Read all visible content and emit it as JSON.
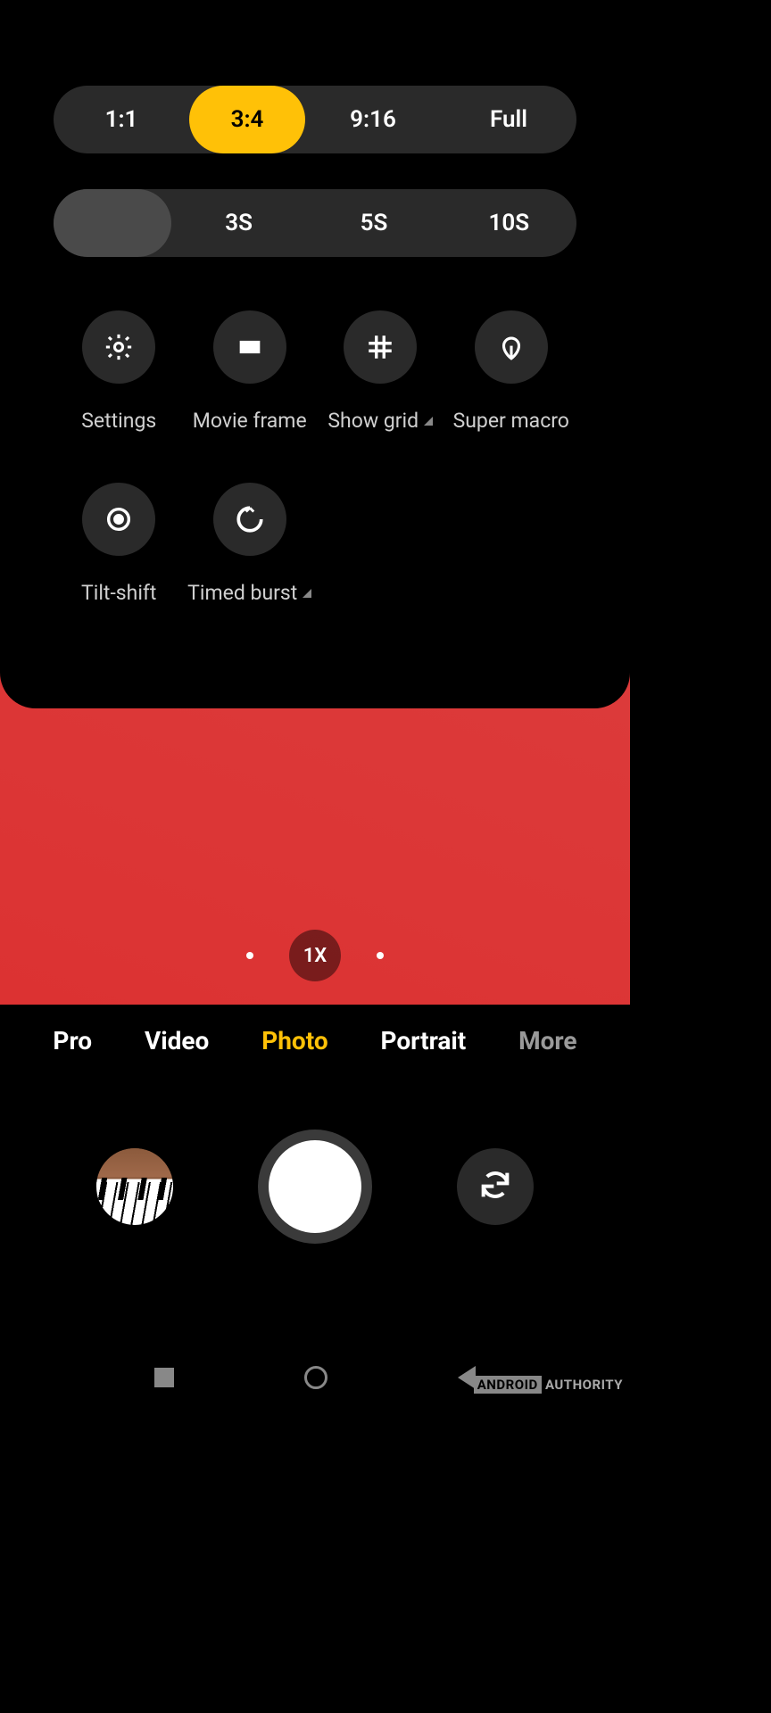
{
  "aspect_ratio": {
    "options": [
      "1:1",
      "3:4",
      "9:16",
      "Full"
    ],
    "active_index": 1
  },
  "timer": {
    "icon": "clock-icon",
    "options": [
      "3S",
      "5S",
      "10S"
    ],
    "active_index": -1
  },
  "quick_settings_row1": [
    {
      "label": "Settings",
      "icon": "gear-icon",
      "has_submenu": false
    },
    {
      "label": "Movie frame",
      "icon": "movie-frame-icon",
      "has_submenu": false
    },
    {
      "label": "Show grid",
      "icon": "grid-icon",
      "has_submenu": true
    },
    {
      "label": "Super macro",
      "icon": "macro-icon",
      "has_submenu": false
    }
  ],
  "quick_settings_row2": [
    {
      "label": "Tilt-shift",
      "icon": "tilt-shift-icon",
      "has_submenu": false
    },
    {
      "label": "Timed burst",
      "icon": "timed-burst-icon",
      "has_submenu": true
    }
  ],
  "zoom": {
    "level": "1X",
    "has_lower": true,
    "has_higher": true
  },
  "modes": [
    "Pro",
    "Video",
    "Photo",
    "Portrait",
    "More"
  ],
  "modes_active_index": 2,
  "controls": {
    "gallery_description": "piano-keys-thumbnail",
    "shutter": "shutter",
    "swap": "camera-swap-icon"
  },
  "nav": [
    "recent",
    "home",
    "back"
  ],
  "watermark": {
    "brand_box": "ANDROID",
    "brand_rest": "AUTHORITY"
  },
  "colors": {
    "accent": "#ffc107",
    "pill_bg": "#2a2a2a",
    "pill_active_bg_secondary": "#4a4a4a"
  }
}
